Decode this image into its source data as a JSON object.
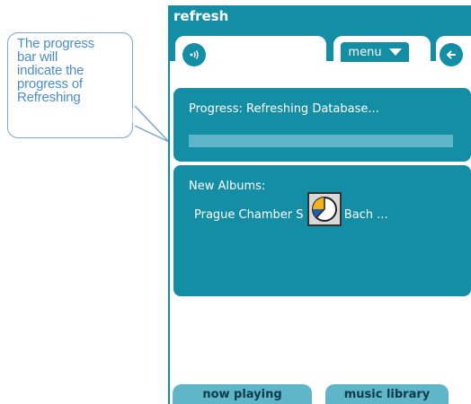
{
  "callout": {
    "text_lines": [
      "The progress",
      "bar will",
      "indicate the",
      "progress of",
      "Refreshing"
    ]
  },
  "window": {
    "title": "refresh"
  },
  "toolbar": {
    "speaker_icon": "speaker-icon",
    "menu_label": "menu",
    "menu_icon": "chevron-down-icon",
    "back_icon": "back-arrow-icon"
  },
  "progress": {
    "label": "Progress: Refreshing Database...",
    "fraction": 0
  },
  "albums": {
    "label": "New Albums:",
    "items": [
      "Prague Chamber S",
      "- J.S. Bach ..."
    ]
  },
  "busy_indicator": {
    "icon": "busy-pie-icon"
  },
  "bottom_nav": {
    "now_playing": "now playing",
    "music_library": "music library"
  },
  "colors": {
    "accent": "#138ea4",
    "light_accent": "#5fb6c9",
    "callout_text": "#4a8ec8",
    "busy_blue": "#1f5fa8",
    "busy_yellow": "#f2b21a"
  }
}
